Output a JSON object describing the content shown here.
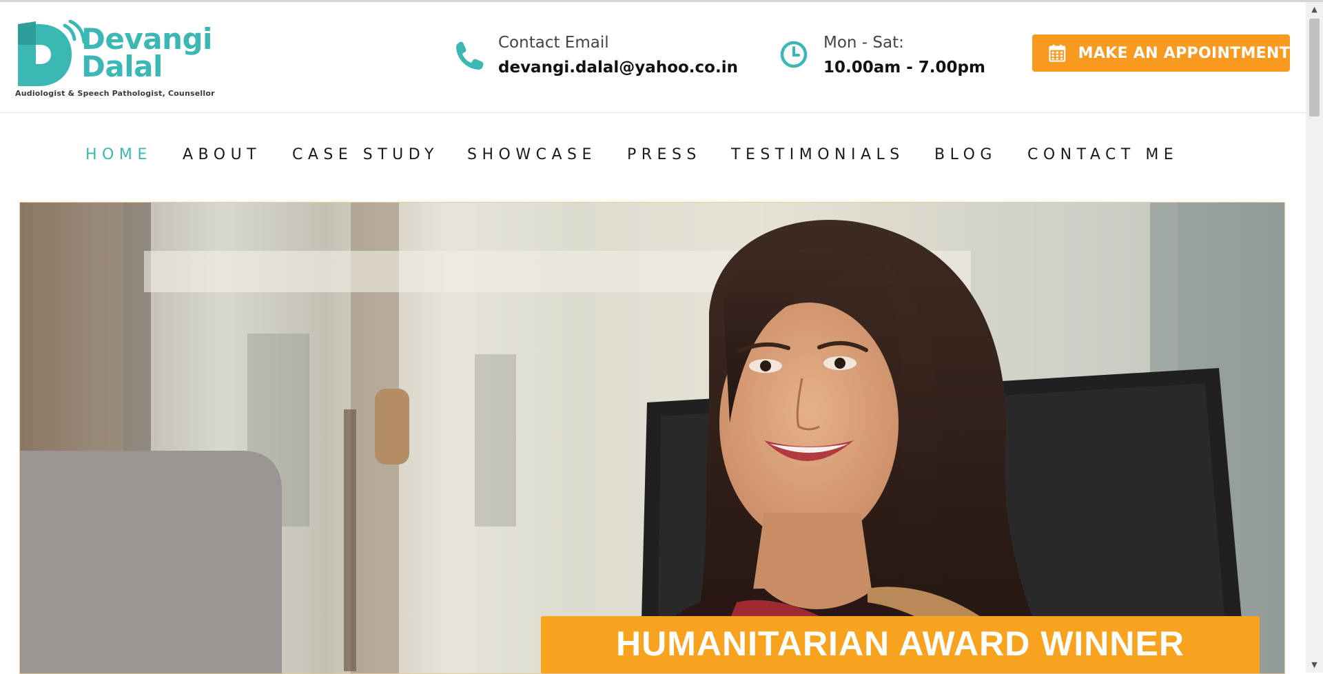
{
  "brand": {
    "name_line1": "Devangi",
    "name_line2": "Dalal",
    "tagline": "Audiologist & Speech Pathologist, Counsellor",
    "color_teal": "#3bb8b3",
    "color_orange": "#f89a1f"
  },
  "header": {
    "email": {
      "icon": "phone-icon",
      "label": "Contact Email",
      "value": "devangi.dalal@yahoo.co.in"
    },
    "hours": {
      "icon": "clock-icon",
      "label": "Mon - Sat:",
      "value": "10.00am - 7.00pm"
    },
    "appointment_button": {
      "icon": "calendar-icon",
      "label": "MAKE AN APPOINTMENT"
    }
  },
  "nav": {
    "items": [
      {
        "label": "HOME",
        "active": true
      },
      {
        "label": "ABOUT",
        "active": false
      },
      {
        "label": "CASE STUDY",
        "active": false
      },
      {
        "label": "SHOWCASE",
        "active": false
      },
      {
        "label": "PRESS",
        "active": false
      },
      {
        "label": "TESTIMONIALS",
        "active": false
      },
      {
        "label": "BLOG",
        "active": false
      },
      {
        "label": "CONTACT ME",
        "active": false
      }
    ]
  },
  "hero": {
    "banner_text": "HUMANITARIAN AWARD WINNER"
  }
}
